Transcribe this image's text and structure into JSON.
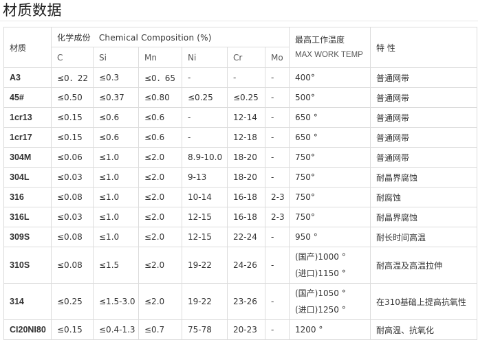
{
  "page": {
    "title": "材质数据"
  },
  "table": {
    "headers": {
      "material": "材质",
      "composition_cn": "化学成份",
      "composition_en": "Chemical Composition (%)",
      "elements": [
        "C",
        "Si",
        "Mn",
        "Ni",
        "Cr",
        "Mo"
      ],
      "max_temp_cn": "最高工作温度",
      "max_temp_en": "MAX WORK TEMP",
      "property": "特 性"
    },
    "rows": [
      {
        "material": "A3",
        "c": "≤0．22",
        "si": "≤0.3",
        "mn": "≤0．65",
        "ni": "-",
        "cr": "-",
        "mo": "-",
        "temp": [
          "400°"
        ],
        "property": "普通网带"
      },
      {
        "material": "45#",
        "c": "≤0.50",
        "si": "≤0.37",
        "mn": "≤0.80",
        "ni": "≤0.25",
        "cr": "≤0.25",
        "mo": "-",
        "temp": [
          "500°"
        ],
        "property": "普通网带"
      },
      {
        "material": "1cr13",
        "c": "≤0.15",
        "si": "≤0.6",
        "mn": "≤0.6",
        "ni": "-",
        "cr": "12-14",
        "mo": "-",
        "temp": [
          "650 °"
        ],
        "property": "普通网带"
      },
      {
        "material": "1cr17",
        "c": "≤0.15",
        "si": "≤0.6",
        "mn": "≤0.6",
        "ni": "-",
        "cr": "12-18",
        "mo": "-",
        "temp": [
          "650 °"
        ],
        "property": "普通网带"
      },
      {
        "material": "304M",
        "c": "≤0.06",
        "si": "≤1.0",
        "mn": "≤2.0",
        "ni": "8.9-10.0",
        "cr": "18-20",
        "mo": "-",
        "temp": [
          "750°"
        ],
        "property": "普通网带"
      },
      {
        "material": "304L",
        "c": "≤0.03",
        "si": "≤1.0",
        "mn": "≤2.0",
        "ni": "9-13",
        "cr": "18-20",
        "mo": "-",
        "temp": [
          "750°"
        ],
        "property": "耐晶界腐蚀"
      },
      {
        "material": "316",
        "c": "≤0.08",
        "si": "≤1.0",
        "mn": "≤2.0",
        "ni": "10-14",
        "cr": "16-18",
        "mo": "2-3",
        "temp": [
          "750°"
        ],
        "property": "耐腐蚀"
      },
      {
        "material": "316L",
        "c": "≤0.03",
        "si": "≤1.0",
        "mn": "≤2.0",
        "ni": "12-15",
        "cr": "16-18",
        "mo": "2-3",
        "temp": [
          "750°"
        ],
        "property": "耐晶界腐蚀"
      },
      {
        "material": "309S",
        "c": "≤0.08",
        "si": "≤1.0",
        "mn": "≤2.0",
        "ni": "12-15",
        "cr": "22-24",
        "mo": "-",
        "temp": [
          "950 °"
        ],
        "property": "耐长时间高温"
      },
      {
        "material": "310S",
        "c": "≤0.08",
        "si": "≤1.5",
        "mn": "≤2.0",
        "ni": "19-22",
        "cr": "24-26",
        "mo": "-",
        "temp": [
          "(国产)1000 °",
          "(进口)1150 °"
        ],
        "property": "耐高温及高温拉伸"
      },
      {
        "material": "314",
        "c": "≤0.25",
        "si": "≤1.5-3.0",
        "mn": "≤2.0",
        "ni": "19-22",
        "cr": "23-26",
        "mo": "-",
        "temp": [
          "(国产)1050 °",
          "(进口)1250 °"
        ],
        "property": "在310基础上提高抗氧性"
      },
      {
        "material": "CI20NI80",
        "c": "≤0.15",
        "si": "≤0.4-1.3",
        "mn": "≤0.7",
        "ni": "75-78",
        "cr": "20-23",
        "mo": "-",
        "temp": [
          "1200 °"
        ],
        "property": "耐高温、抗氧化"
      }
    ]
  }
}
